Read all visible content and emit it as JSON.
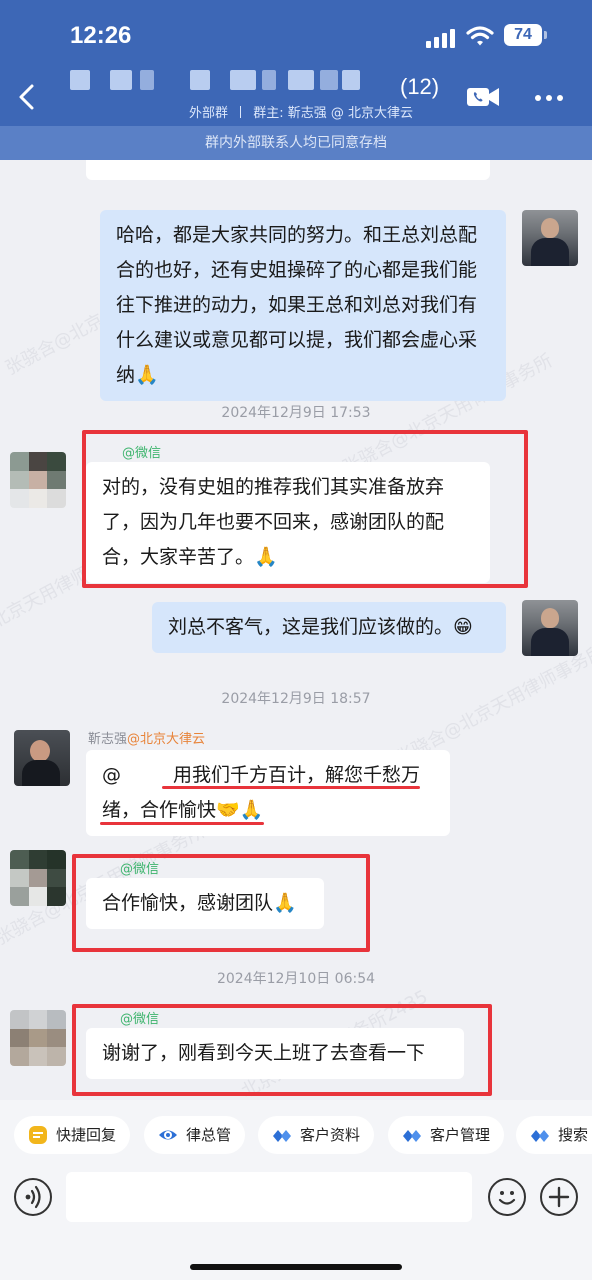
{
  "status_bar": {
    "time": "12:26",
    "battery": "74"
  },
  "header": {
    "member_count": "(12)",
    "subtitle_group": "外部群",
    "subtitle_owner": "群主: 靳志强 @ 北京大律云",
    "notice": "群内外部联系人均已同意存档",
    "icons": [
      "back-icon",
      "video-call-icon",
      "more-icon"
    ]
  },
  "watermarks": [
    "张骁含@北京天用律师事务所2435",
    "北京天用律师事务所2435",
    "张骁含@北京天用律师事务所"
  ],
  "messages": [
    {
      "id": "m1",
      "side": "out",
      "text": "哈哈，都是大家共同的努力。和王总刘总配合的也好，还有史姐操碎了的心都是我们能往下推进的动力，如果王总和刘总对我们有什么建议或意见都可以提，我们都会虚心采纳🙏"
    },
    {
      "id": "ts1",
      "type": "timestamp",
      "text": "2024年12月9日 17:53"
    },
    {
      "id": "m2",
      "side": "in",
      "tag": "@微信",
      "text": "对的，没有史姐的推荐我们其实准备放弃了，因为几年也要不回来，感谢团队的配合，大家辛苦了。🙏"
    },
    {
      "id": "m3",
      "side": "out",
      "text": "刘总不客气，这是我们应该做的。😁"
    },
    {
      "id": "ts2",
      "type": "timestamp",
      "text": "2024年12月9日 18:57"
    },
    {
      "id": "m4",
      "side": "in",
      "sender_name": "靳志强",
      "sender_org": "@北京大律云",
      "mention": "@",
      "text": "用我们千方百计，解您千愁万绪，合作愉快🤝🙏"
    },
    {
      "id": "m5",
      "side": "in",
      "tag": "@微信",
      "text": "合作愉快，感谢团队🙏"
    },
    {
      "id": "ts3",
      "type": "timestamp",
      "text": "2024年12月10日 06:54"
    },
    {
      "id": "m6",
      "side": "in",
      "tag": "@微信",
      "text": "谢谢了，刚看到今天上班了去查看一下"
    }
  ],
  "quick_actions": [
    {
      "label": "快捷回复",
      "icon": "quick-reply-icon",
      "color": "#f2b61c"
    },
    {
      "label": "律总管",
      "icon": "eye-icon",
      "color": "#2c6fd6"
    },
    {
      "label": "客户资料",
      "icon": "client-info-icon",
      "color": "#2c6fd6"
    },
    {
      "label": "客户管理",
      "icon": "client-manage-icon",
      "color": "#2c6fd6"
    },
    {
      "label": "搜索",
      "icon": "search-icon",
      "color": "#2c6fd6"
    }
  ],
  "colors": {
    "header_bg": "#3d67b6",
    "bubble_out": "#d6e6fb",
    "highlight_red": "#e8343b",
    "wechat_green": "#3db46d"
  }
}
